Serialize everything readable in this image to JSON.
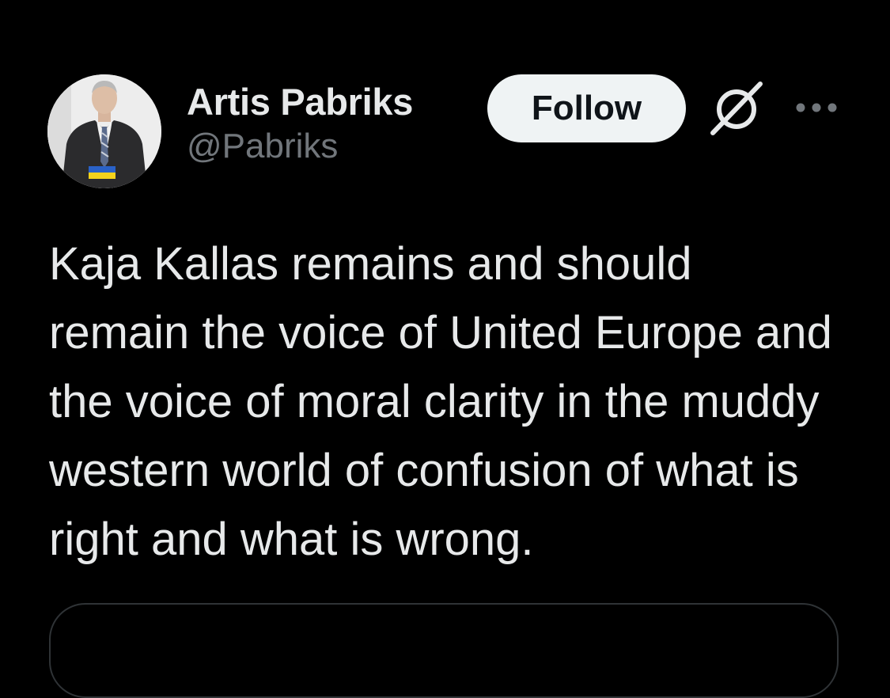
{
  "author": {
    "display_name": "Artis Pabriks",
    "handle": "@Pabriks",
    "avatar_icon": "profile-photo"
  },
  "actions": {
    "follow_label": "Follow",
    "grok_icon": "grok-icon",
    "more_icon": "more-options-icon"
  },
  "tweet": {
    "text": "Kaja Kallas remains and should remain the voice of United Europe and the voice of moral clarity in the muddy western world of confusion of what is right and what is wrong."
  },
  "colors": {
    "background": "#000000",
    "text_primary": "#e7e9ea",
    "text_secondary": "#71767b",
    "follow_bg": "#eff3f4",
    "follow_text": "#0f1419",
    "border": "#2f3336"
  }
}
